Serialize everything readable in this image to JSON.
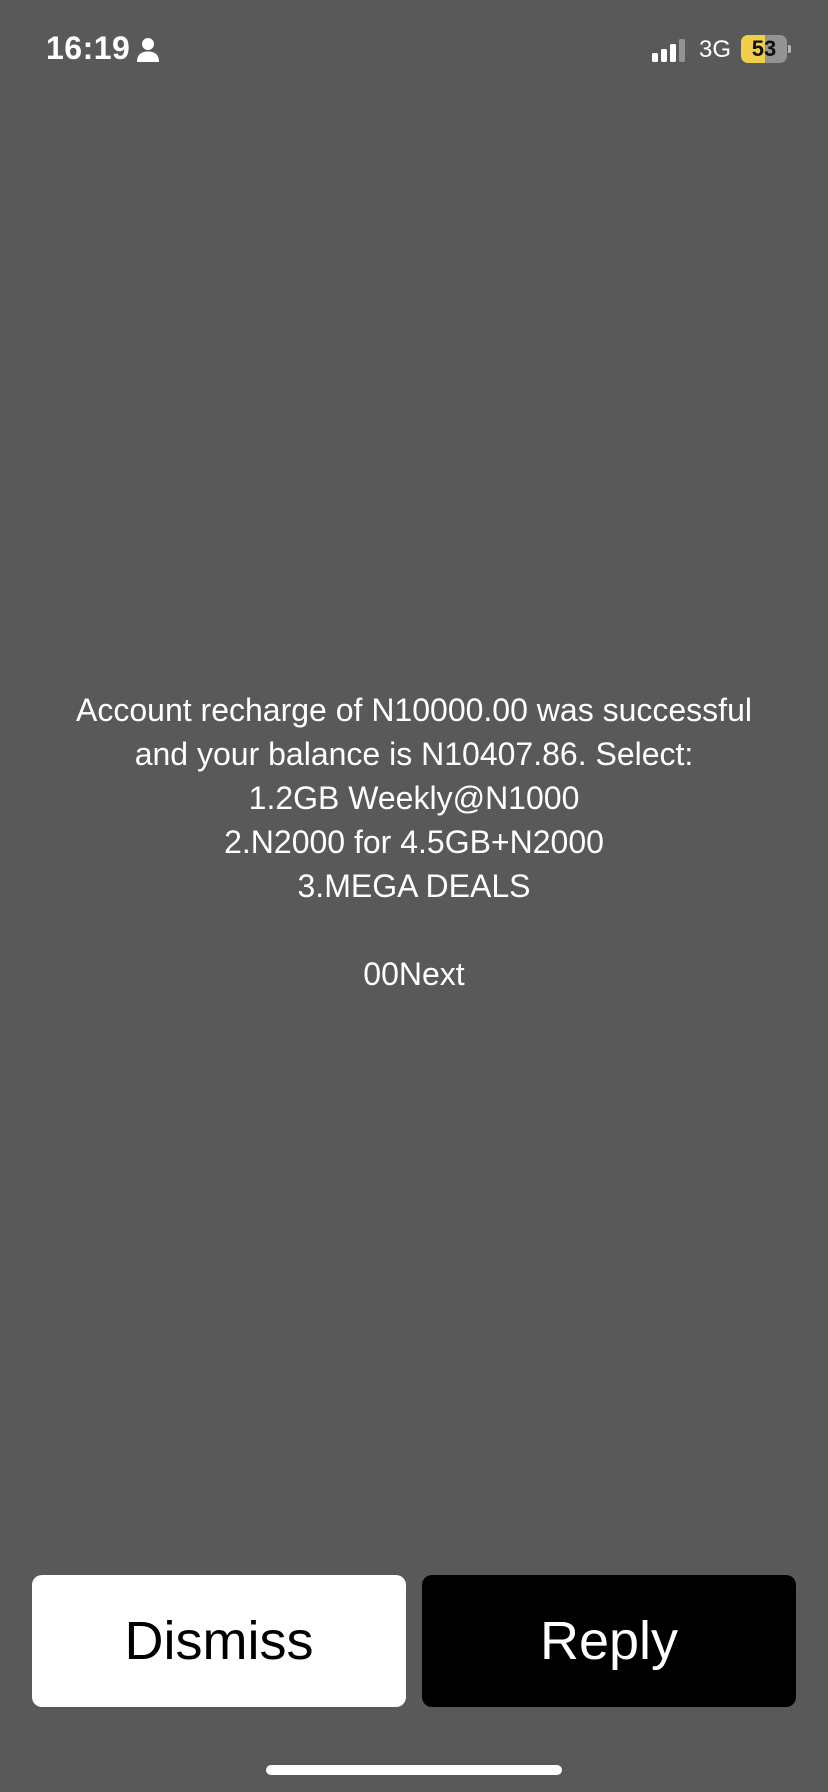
{
  "status_bar": {
    "time": "16:19",
    "network": "3G",
    "battery_level": "53",
    "battery_fraction": 0.53,
    "battery_color": "#f1cf4b",
    "icons": [
      "person-icon",
      "signal-icon",
      "battery-icon"
    ]
  },
  "message": {
    "lines": [
      "Account recharge of N10000.00 was successful",
      "and your balance is N10407.86. Select:",
      "1.2GB Weekly@N1000",
      "2.N2000 for 4.5GB+N2000",
      "3.MEGA DEALS",
      "",
      "00Next"
    ]
  },
  "actions": {
    "dismiss_label": "Dismiss",
    "reply_label": "Reply"
  },
  "colors": {
    "background": "#595959",
    "dismiss_bg": "#ffffff",
    "reply_bg": "#000000"
  }
}
